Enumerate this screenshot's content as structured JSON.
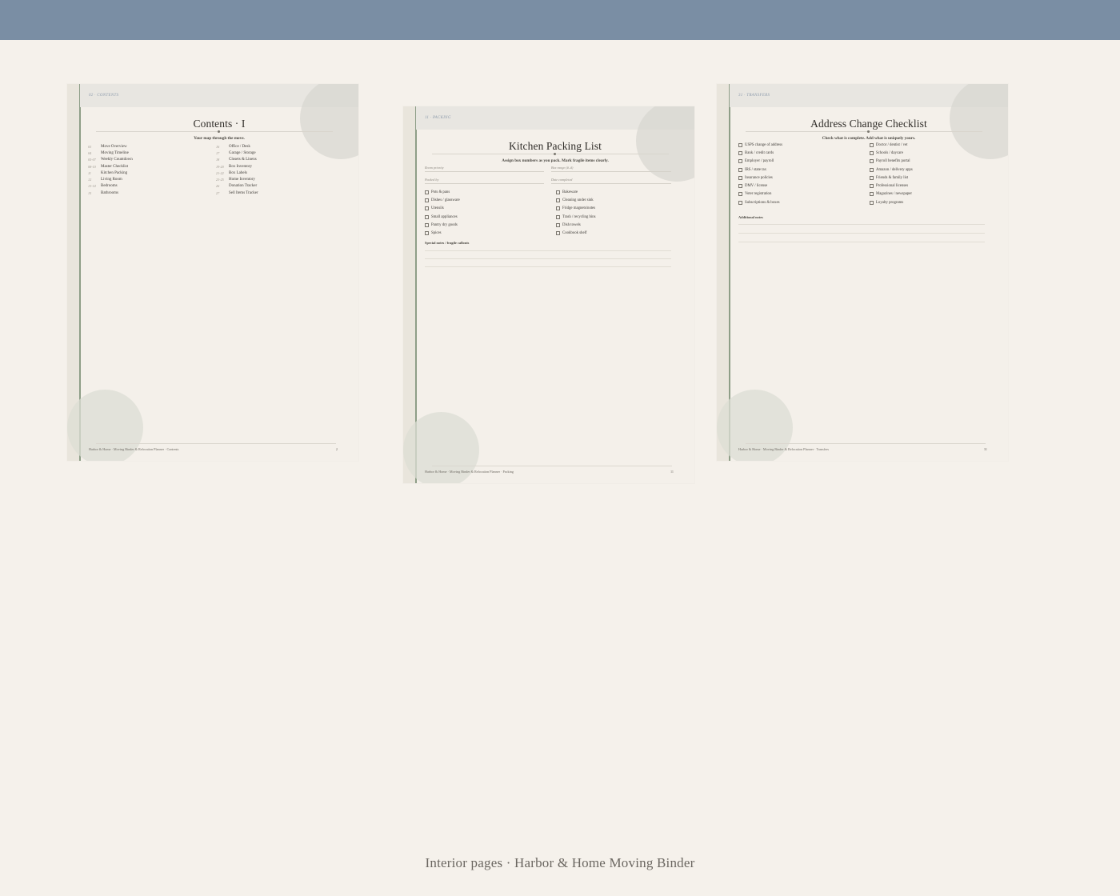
{
  "caption": "Interior pages · Harbor & Home Moving Binder",
  "contents": {
    "header": "02 · CONTENTS",
    "title": "Contents  · I",
    "subtitle": "Your map through the move.",
    "left": [
      {
        "num": "03",
        "label": "Move Overview"
      },
      {
        "num": "04",
        "label": "Moving Timeline"
      },
      {
        "num": "05-07",
        "label": "Weekly Countdown"
      },
      {
        "num": "08-10",
        "label": "Master Checklist"
      },
      {
        "num": "11",
        "label": "Kitchen Packing"
      },
      {
        "num": "12",
        "label": "Living Room"
      },
      {
        "num": "13-14",
        "label": "Bedrooms"
      },
      {
        "num": "15",
        "label": "Bathrooms"
      }
    ],
    "right": [
      {
        "num": "16",
        "label": "Office / Desk"
      },
      {
        "num": "17",
        "label": "Garage / Storage"
      },
      {
        "num": "18",
        "label": "Closets & Linens"
      },
      {
        "num": "19-20",
        "label": "Box Inventory"
      },
      {
        "num": "21-22",
        "label": "Box Labels"
      },
      {
        "num": "23-25",
        "label": "Home Inventory"
      },
      {
        "num": "26",
        "label": "Donation Tracker"
      },
      {
        "num": "27",
        "label": "Sell Items Tracker"
      }
    ],
    "footer_left": "Harbor & Home · Moving Binder & Relocation Planner · Contents",
    "footer_right": "2"
  },
  "kitchen": {
    "header": "11 · PACKING",
    "title": "Kitchen Packing List",
    "subtitle": "Assign box numbers as you pack. Mark fragile items clearly.",
    "fields": [
      "Room priority",
      "Box range (#–#)",
      "Packed by",
      "Date completed"
    ],
    "left": [
      "Pots & pans",
      "Dishes / glassware",
      "Utensils",
      "Small appliances",
      "Pantry dry goods",
      "Spices"
    ],
    "right": [
      "Bakeware",
      "Cleaning under sink",
      "Fridge magnets/notes",
      "Trash / recycling bins",
      "Dish towels",
      "Cookbook shelf"
    ],
    "notes_label": "Special notes / fragile callouts",
    "footer_left": "Harbor & Home · Moving Binder & Relocation Planner · Packing",
    "footer_right": "11"
  },
  "address": {
    "header": "31 · TRANSFERS",
    "title": "Address Change Checklist",
    "subtitle": "Check what is complete. Add what is uniquely yours.",
    "left": [
      "USPS change of address",
      "Bank / credit cards",
      "Employer / payroll",
      "IRS / state tax",
      "Insurance policies",
      "DMV / license",
      "Voter registration",
      "Subscriptions & boxes"
    ],
    "right": [
      "Doctor / dentist / vet",
      "Schools / daycare",
      "Payroll benefits portal",
      "Amazon / delivery apps",
      "Friends & family list",
      "Professional licenses",
      "Magazines / newspaper",
      "Loyalty programs"
    ],
    "notes_label": "Additional notes",
    "footer_left": "Harbor & Home · Moving Binder & Relocation Planner · Transfers",
    "footer_right": "31"
  }
}
